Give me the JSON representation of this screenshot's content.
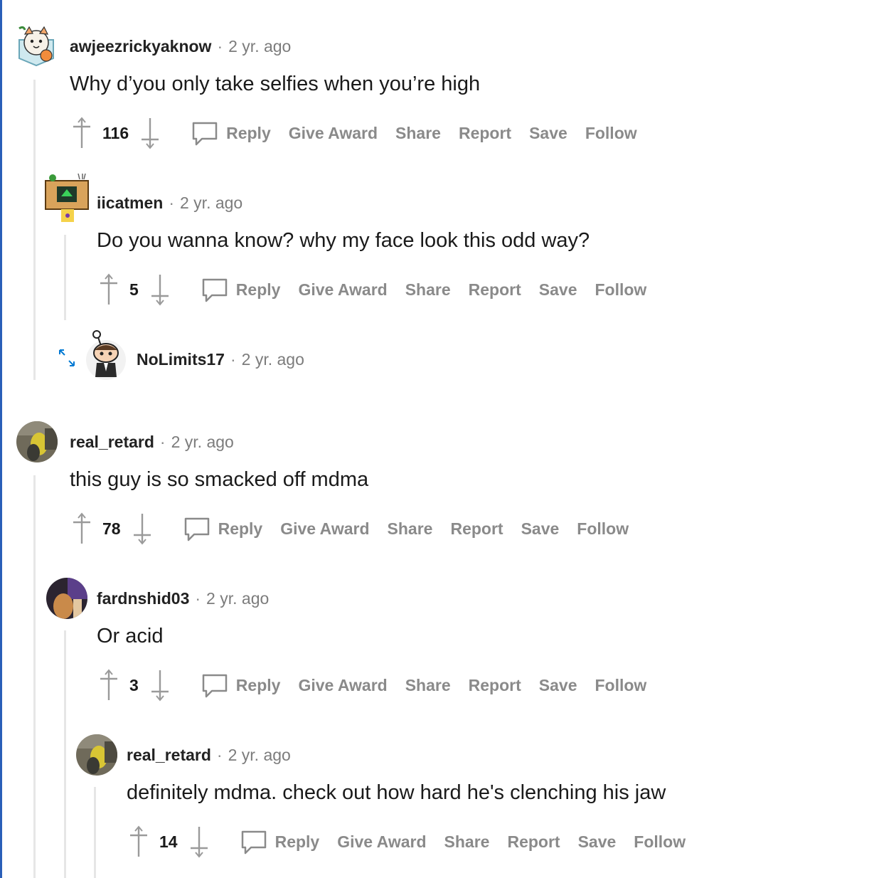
{
  "action_labels": {
    "reply": "Reply",
    "award": "Give Award",
    "share": "Share",
    "report": "Report",
    "save": "Save",
    "follow": "Follow"
  },
  "comments": [
    {
      "username": "awjeezrickyaknow",
      "time": "2 yr. ago",
      "text": "Why d’you only take selfies when you’re high",
      "score": "116",
      "avatar": "cat-avatar"
    },
    {
      "username": "iicatmen",
      "time": "2 yr. ago",
      "text": "Do you wanna know? why my face look this odd way?",
      "score": "5",
      "avatar": "box-head-avatar"
    },
    {
      "username": "NoLimits17",
      "time": "2 yr. ago",
      "collapsed": true,
      "avatar": "snoo-avatar"
    },
    {
      "username": "real_retard",
      "time": "2 yr. ago",
      "text": "this guy is so smacked off mdma",
      "score": "78",
      "avatar": "photo-avatar"
    },
    {
      "username": "fardnshid03",
      "time": "2 yr. ago",
      "text": "Or acid",
      "score": "3",
      "avatar": "photo-avatar"
    },
    {
      "username": "real_retard",
      "time": "2 yr. ago",
      "text": "definitely mdma. check out how hard he's clenching his jaw",
      "score": "14",
      "avatar": "photo-avatar"
    }
  ],
  "separator": "·",
  "colors": {
    "accent_left_edge": "#2a5fb8",
    "thread_line": "#e6e6e6",
    "muted_text": "#8a8a8a",
    "expand_icon": "#0079d3"
  }
}
